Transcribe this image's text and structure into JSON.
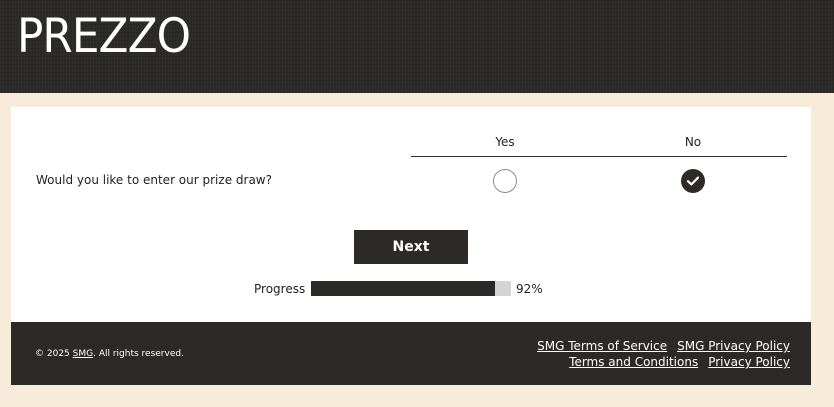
{
  "header": {
    "logo_text": "PREZZO"
  },
  "survey": {
    "columns": [
      "Yes",
      "No"
    ],
    "question": "Would you like to enter our prize draw?",
    "selected": "No"
  },
  "actions": {
    "next_label": "Next"
  },
  "progress": {
    "label": "Progress",
    "value": 92,
    "percent_text": "92%"
  },
  "footer": {
    "copyright_prefix": "© 2025 ",
    "company": "SMG",
    "copyright_suffix": ". All rights reserved.",
    "links_row1": [
      "SMG Terms of Service",
      "SMG Privacy Policy"
    ],
    "links_row2": [
      "Terms and Conditions",
      "Privacy Policy"
    ]
  },
  "colors": {
    "header_bg": "#2b2a28",
    "page_bg": "#f7ebda",
    "accent_dark": "#2d2926",
    "progress_track": "#d4d4d8"
  }
}
